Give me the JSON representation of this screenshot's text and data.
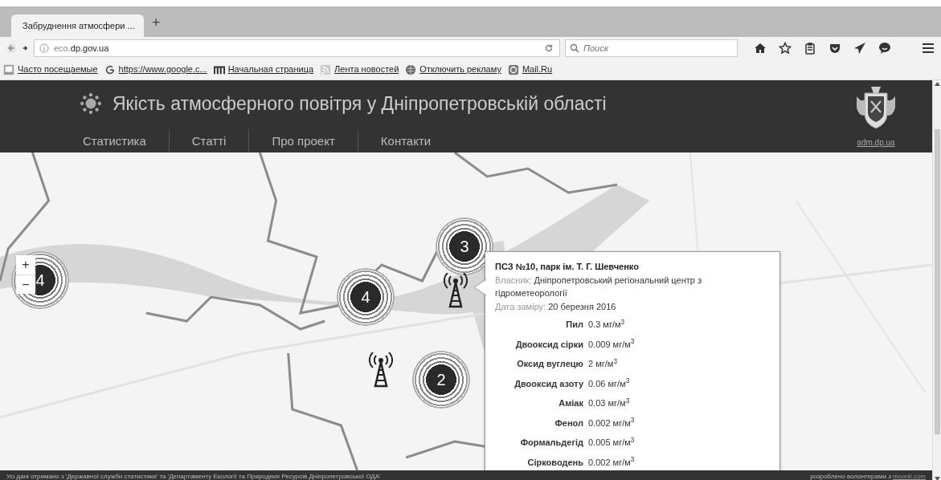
{
  "browser": {
    "tabs": [
      {
        "title": "Забруднення атмосфери ...",
        "selected": true
      }
    ],
    "new_tab": "+",
    "address": {
      "host_prefix": "eco.",
      "host": "dp.gov.ua"
    },
    "search": {
      "placeholder": "Поиск"
    },
    "bookmarks": [
      {
        "label": "Часто посещаемые"
      },
      {
        "label": "https://www.google.c..."
      },
      {
        "label": "Начальная страница"
      },
      {
        "label": "Лента новостей"
      },
      {
        "label": "Отключить рекламу"
      },
      {
        "label": "Mail.Ru"
      }
    ]
  },
  "header": {
    "title": "Якість атмосферного повітря у Дніпропетровській області",
    "nav": [
      "Статистика",
      "Статті",
      "Про проект",
      "Контакти"
    ],
    "logo_link": "adm.dp.ua"
  },
  "map": {
    "kind": "picture",
    "zoom": [
      "+",
      "−"
    ],
    "clusters": [
      {
        "count": "4"
      },
      {
        "count": "4"
      },
      {
        "count": "3"
      },
      {
        "count": "2"
      }
    ],
    "popup": {
      "title": "ПСЗ №10, парк ім. Т. Г. Шевченко",
      "owner_label": "Власник:",
      "owner": "Дніпропетровський регіональний центр з гідрометеорології",
      "date_label": "Дата заміру:",
      "date": "20 березня 2016",
      "rows": [
        {
          "name": "Пил",
          "value": "0.3 мг/м$^{3}$"
        },
        {
          "name": "Двооксид сірки",
          "value": "0.009 мг/м$^{3}$"
        },
        {
          "name": "Оксид вуглецю",
          "value": "2 мг/м$^{3}$"
        },
        {
          "name": "Двооксид азоту",
          "value": "0.06 мг/м$^{3}$"
        },
        {
          "name": "Аміак",
          "value": "0.03 мг/м$^{3}$"
        },
        {
          "name": "Фенол",
          "value": "0.002 мг/м$^{3}$"
        },
        {
          "name": "Формальдегід",
          "value": "0.005 мг/м$^{3}$"
        },
        {
          "name": "Сірководень",
          "value": "0.002 мг/м$^{3}$"
        }
      ]
    }
  },
  "footer": {
    "source": "Усі дані отримано з 'Державної служби статистики' та 'Департаменту Екології та Природних Ресурсів Дніпропетровської ОДА'",
    "credit": "розроблено волонтерами з",
    "credit_link": "moonli.com"
  }
}
